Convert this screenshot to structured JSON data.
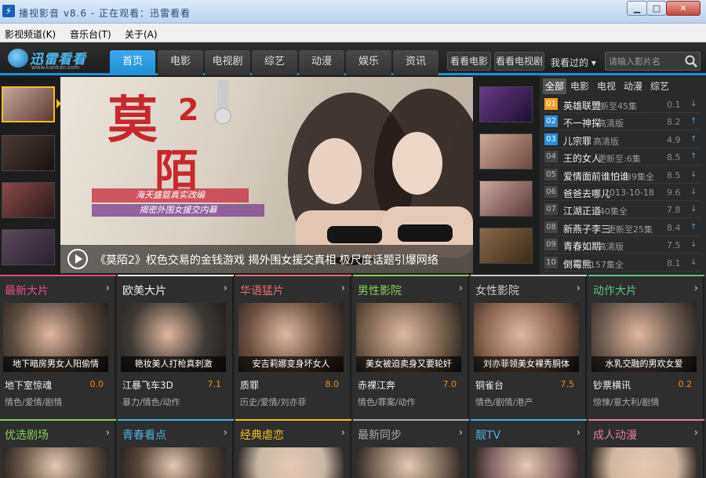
{
  "window": {
    "title": "播视影音 v8.6 - 正在观看：迅雷看看",
    "icon": "lightning-icon",
    "min_label": "▁",
    "max_label": "□",
    "close_label": "✕"
  },
  "menu": [
    "影视频道(K)",
    "音乐台(T)",
    "关于(A)"
  ],
  "nav": {
    "logo_text": "迅雷看看",
    "logo_sub": "www.kankan.com",
    "tabs": [
      "首页",
      "电影",
      "电视剧",
      "综艺",
      "动漫",
      "娱乐",
      "资讯"
    ],
    "subtabs": [
      "看看电影",
      "看看电视剧"
    ],
    "watched_label": "我看过的 ▾",
    "search_placeholder": "请输入影片名"
  },
  "hero": {
    "title_char": "莫",
    "title_char2": "陌",
    "title_num": "2",
    "ribbon1": "海天盛筵真实改编",
    "ribbon2": "揭密外围女援交内幕",
    "caption": "《莫陌2》权色交易的金钱游戏 揭外围女援交真相 极尺度话题引爆网络"
  },
  "ranking": {
    "tabs": [
      "全部",
      "电影",
      "电视",
      "动漫",
      "综艺"
    ],
    "items": [
      {
        "num": "01",
        "name": "英雄联盟",
        "sub": "更新至45集",
        "score": "0.1",
        "trend": "down"
      },
      {
        "num": "02",
        "name": "不一神探",
        "sub": "高清版",
        "score": "8.2",
        "trend": "up"
      },
      {
        "num": "03",
        "name": "儿宗罪",
        "sub": "高清版",
        "score": "4.9",
        "trend": "up"
      },
      {
        "num": "04",
        "name": "王的女人",
        "sub": "更新至:6集",
        "score": "8.5",
        "trend": "up"
      },
      {
        "num": "05",
        "name": "爱情面前谁怕谁",
        "sub": "39集全",
        "score": "8.5",
        "trend": "down"
      },
      {
        "num": "06",
        "name": "爸爸去哪儿",
        "sub": "2013-10-18",
        "score": "9.6",
        "trend": "down"
      },
      {
        "num": "07",
        "name": "江湖正道",
        "sub": "40集全",
        "score": "7.8",
        "trend": "down"
      },
      {
        "num": "08",
        "name": "新燕子李三",
        "sub": "更新至25集",
        "score": "8.4",
        "trend": "up"
      },
      {
        "num": "09",
        "name": "青春如期",
        "sub": "高清版",
        "score": "7.5",
        "trend": "down"
      },
      {
        "num": "10",
        "name": "倒霉熊",
        "sub": "157集全",
        "score": "8.1",
        "trend": "down"
      }
    ]
  },
  "categories_row1": [
    {
      "title": "最新大片",
      "color": "#e0508a",
      "poster": "地下暗房男女人阳偷情",
      "movie": "地下室惊魂",
      "score": "0.0",
      "tags": "情色/爱情/剧情",
      "bg": "#5a4a3e"
    },
    {
      "title": "欧美大片",
      "color": "#eeeeee",
      "poster": "艳妆美人打枪真刺激",
      "movie": "江暴飞车3D",
      "score": "7.1",
      "tags": "暴力/情色/动作",
      "bg": "#3e3a36"
    },
    {
      "title": "华语猛片",
      "color": "#e07070",
      "poster": "安吉莉娜变身坏女人",
      "movie": "质罪",
      "score": "8.0",
      "tags": "历史/爱情/刘亦菲",
      "bg": "#6a5040"
    },
    {
      "title": "男性影院",
      "color": "#8acc60",
      "poster": "美女被迫卖身又要轮奸",
      "movie": "赤裸江奔",
      "score": "7.0",
      "tags": "情色/罪案/动作",
      "bg": "#7a6450"
    },
    {
      "title": "女性影院",
      "color": "#cccccc",
      "poster": "刘亦菲领美女裸秀胴体",
      "movie": "铜雀台",
      "score": "7.5",
      "tags": "情色/剧情/港产",
      "bg": "#8a6450"
    },
    {
      "title": "动作大片",
      "color": "#60c080",
      "poster": "水乳交融的男欢女爱",
      "movie": "钞票横讯",
      "score": "0.2",
      "tags": "惊悚/意大利/剧情",
      "bg": "#6a5a50"
    }
  ],
  "categories_row2": [
    {
      "title": "优选剧场",
      "color": "#8acc60",
      "bg": "#6a5a4a"
    },
    {
      "title": "青春看点",
      "color": "#4fb0e0",
      "bg": "#5a4a3e"
    },
    {
      "title": "经典虐恋",
      "color": "#f0c020",
      "bg": "#c8b8a8"
    },
    {
      "title": "最新同步",
      "color": "#aaaaaa",
      "bg": "#7a6a5a"
    },
    {
      "title": "靓TV",
      "color": "#4fb0e0",
      "bg": "#8a6a6a"
    },
    {
      "title": "成人动漫",
      "color": "#e080a0",
      "bg": "#d0b8a0"
    }
  ],
  "more_glyph": "›"
}
